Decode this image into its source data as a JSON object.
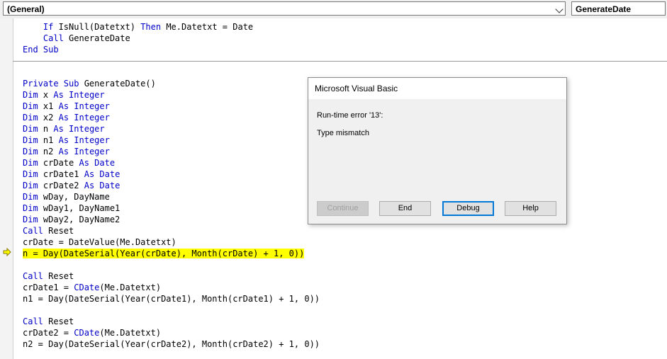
{
  "toolbar": {
    "object_combo": "(General)",
    "procedure_combo": "GenerateDate"
  },
  "code_lines": [
    [
      {
        "t": "    "
      },
      {
        "t": "If",
        "k": 1
      },
      {
        "t": " IsNull(Datetxt) "
      },
      {
        "t": "Then",
        "k": 1
      },
      {
        "t": " Me.Datetxt = Date"
      }
    ],
    [
      {
        "t": "    "
      },
      {
        "t": "Call",
        "k": 1
      },
      {
        "t": " GenerateDate"
      }
    ],
    [
      {
        "t": "End Sub",
        "k": 1
      }
    ],
    [],
    [],
    [
      {
        "t": "Private Sub",
        "k": 1
      },
      {
        "t": " GenerateDate()"
      }
    ],
    [
      {
        "t": "Dim",
        "k": 1
      },
      {
        "t": " x "
      },
      {
        "t": "As Integer",
        "k": 1
      }
    ],
    [
      {
        "t": "Dim",
        "k": 1
      },
      {
        "t": " x1 "
      },
      {
        "t": "As Integer",
        "k": 1
      }
    ],
    [
      {
        "t": "Dim",
        "k": 1
      },
      {
        "t": " x2 "
      },
      {
        "t": "As Integer",
        "k": 1
      }
    ],
    [
      {
        "t": "Dim",
        "k": 1
      },
      {
        "t": " n "
      },
      {
        "t": "As Integer",
        "k": 1
      }
    ],
    [
      {
        "t": "Dim",
        "k": 1
      },
      {
        "t": " n1 "
      },
      {
        "t": "As Integer",
        "k": 1
      }
    ],
    [
      {
        "t": "Dim",
        "k": 1
      },
      {
        "t": " n2 "
      },
      {
        "t": "As Integer",
        "k": 1
      }
    ],
    [
      {
        "t": "Dim",
        "k": 1
      },
      {
        "t": " crDate "
      },
      {
        "t": "As Date",
        "k": 1
      }
    ],
    [
      {
        "t": "Dim",
        "k": 1
      },
      {
        "t": " crDate1 "
      },
      {
        "t": "As Date",
        "k": 1
      }
    ],
    [
      {
        "t": "Dim",
        "k": 1
      },
      {
        "t": " crDate2 "
      },
      {
        "t": "As Date",
        "k": 1
      }
    ],
    [
      {
        "t": "Dim",
        "k": 1
      },
      {
        "t": " wDay, DayName"
      }
    ],
    [
      {
        "t": "Dim",
        "k": 1
      },
      {
        "t": " wDay1, DayName1"
      }
    ],
    [
      {
        "t": "Dim",
        "k": 1
      },
      {
        "t": " wDay2, DayName2"
      }
    ],
    [
      {
        "t": "Call",
        "k": 1
      },
      {
        "t": " Reset"
      }
    ],
    [
      {
        "t": "crDate = DateValue(Me.Datetxt)"
      }
    ],
    [
      {
        "t": "n = Day(DateSerial(Year(crDate), Month(crDate) + 1, 0))",
        "h": 1
      }
    ],
    [],
    [
      {
        "t": "Call",
        "k": 1
      },
      {
        "t": " Reset"
      }
    ],
    [
      {
        "t": "crDate1 = "
      },
      {
        "t": "CDate",
        "k": 1
      },
      {
        "t": "(Me.Datetxt)"
      }
    ],
    [
      {
        "t": "n1 = Day(DateSerial(Year(crDate1), Month(crDate1) + 1, 0))"
      }
    ],
    [],
    [
      {
        "t": "Call",
        "k": 1
      },
      {
        "t": " Reset"
      }
    ],
    [
      {
        "t": "crDate2 = "
      },
      {
        "t": "CDate",
        "k": 1
      },
      {
        "t": "(Me.Datetxt)"
      }
    ],
    [
      {
        "t": "n2 = Day(DateSerial(Year(crDate2), Month(crDate2) + 1, 0))"
      }
    ]
  ],
  "dialog": {
    "title": "Microsoft Visual Basic",
    "error_line": "Run-time error '13':",
    "message": "Type mismatch",
    "buttons": {
      "continue": "Continue",
      "end": "End",
      "debug": "Debug",
      "help": "Help"
    }
  },
  "colors": {
    "keyword": "#0000c8",
    "highlight": "#ffff00",
    "arrow": "#ffff00"
  }
}
